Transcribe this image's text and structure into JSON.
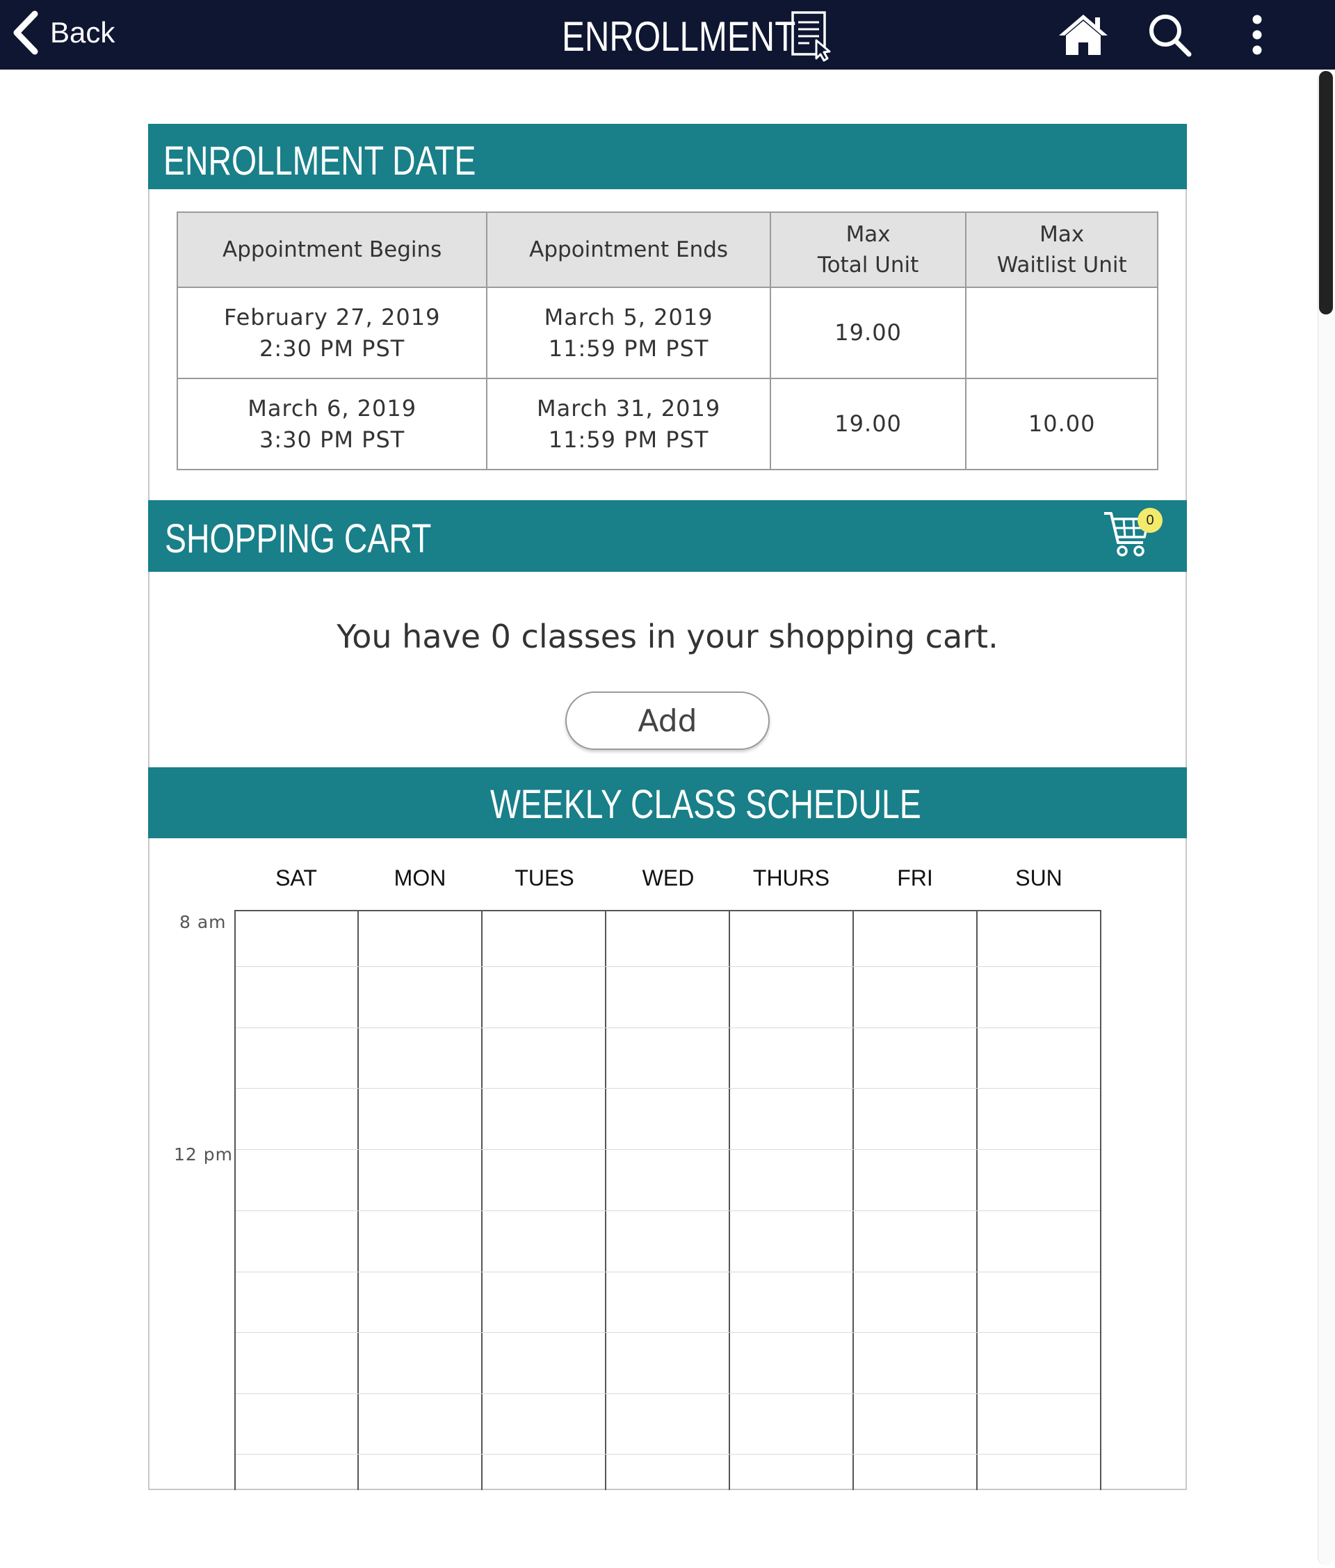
{
  "header": {
    "back_label": "Back",
    "title": "ENROLLMENT",
    "title_icon": "document-cursor-icon",
    "icons": [
      "home-icon",
      "search-icon",
      "more-vertical-icon"
    ]
  },
  "colors": {
    "header_bg": "#0e1631",
    "accent_teal": "#197f89",
    "badge_yellow": "#f3ea6b"
  },
  "enrollment_date": {
    "title": "ENROLLMENT DATE",
    "columns": [
      "Appointment Begins",
      "Appointment Ends",
      "Max\nTotal Unit",
      "Max\nWaitlist Unit"
    ],
    "rows": [
      {
        "begins": "February 27, 2019\n2:30 PM PST",
        "ends": "March 5, 2019\n11:59 PM PST",
        "max_total": "19.00",
        "max_waitlist": ""
      },
      {
        "begins": "March 6, 2019\n3:30 PM PST",
        "ends": "March 31, 2019\n11:59 PM PST",
        "max_total": "19.00",
        "max_waitlist": "10.00"
      }
    ]
  },
  "shopping_cart": {
    "title": "SHOPPING CART",
    "badge_count": "0",
    "message": "You have 0 classes in your shopping cart.",
    "add_label": "Add"
  },
  "schedule": {
    "title": "WEEKLY CLASS SCHEDULE",
    "days": [
      "SAT",
      "MON",
      "TUES",
      "WED",
      "THURS",
      "FRI",
      "SUN"
    ],
    "time_labels": [
      "8 am",
      "12 pm"
    ]
  }
}
